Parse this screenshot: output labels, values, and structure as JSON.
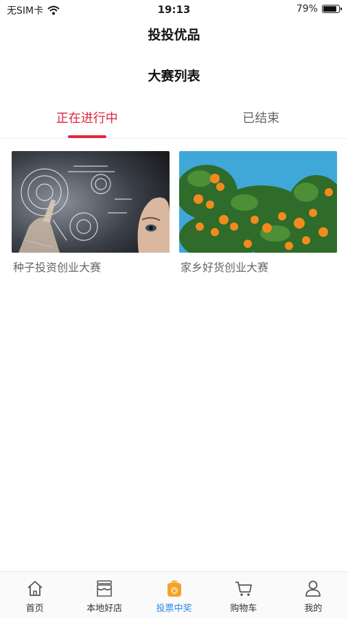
{
  "status_bar": {
    "carrier": "无SIM卡",
    "time": "19:13",
    "battery": "79%",
    "battery_level": 0.79
  },
  "nav": {
    "title": "投投优品"
  },
  "page": {
    "title": "大赛列表"
  },
  "tabs": [
    {
      "label": "正在进行中",
      "active": true
    },
    {
      "label": "已结束",
      "active": false
    }
  ],
  "contests": [
    {
      "title": "种子投资创业大赛",
      "image": "futuristic-touch-interface-photo"
    },
    {
      "title": "家乡好货创业大赛",
      "image": "orange-tree-photo"
    }
  ],
  "tab_bar": {
    "items": [
      {
        "label": "首页",
        "icon": "home-icon"
      },
      {
        "label": "本地好店",
        "icon": "store-icon"
      },
      {
        "label": "投票中奖",
        "icon": "vote-prize-icon",
        "active": true
      },
      {
        "label": "购物车",
        "icon": "cart-icon"
      },
      {
        "label": "我的",
        "icon": "profile-icon"
      }
    ]
  },
  "colors": {
    "accent_red": "#e2243b",
    "active_blue": "#2a8ae8",
    "prize_orange": "#f4a12e"
  }
}
